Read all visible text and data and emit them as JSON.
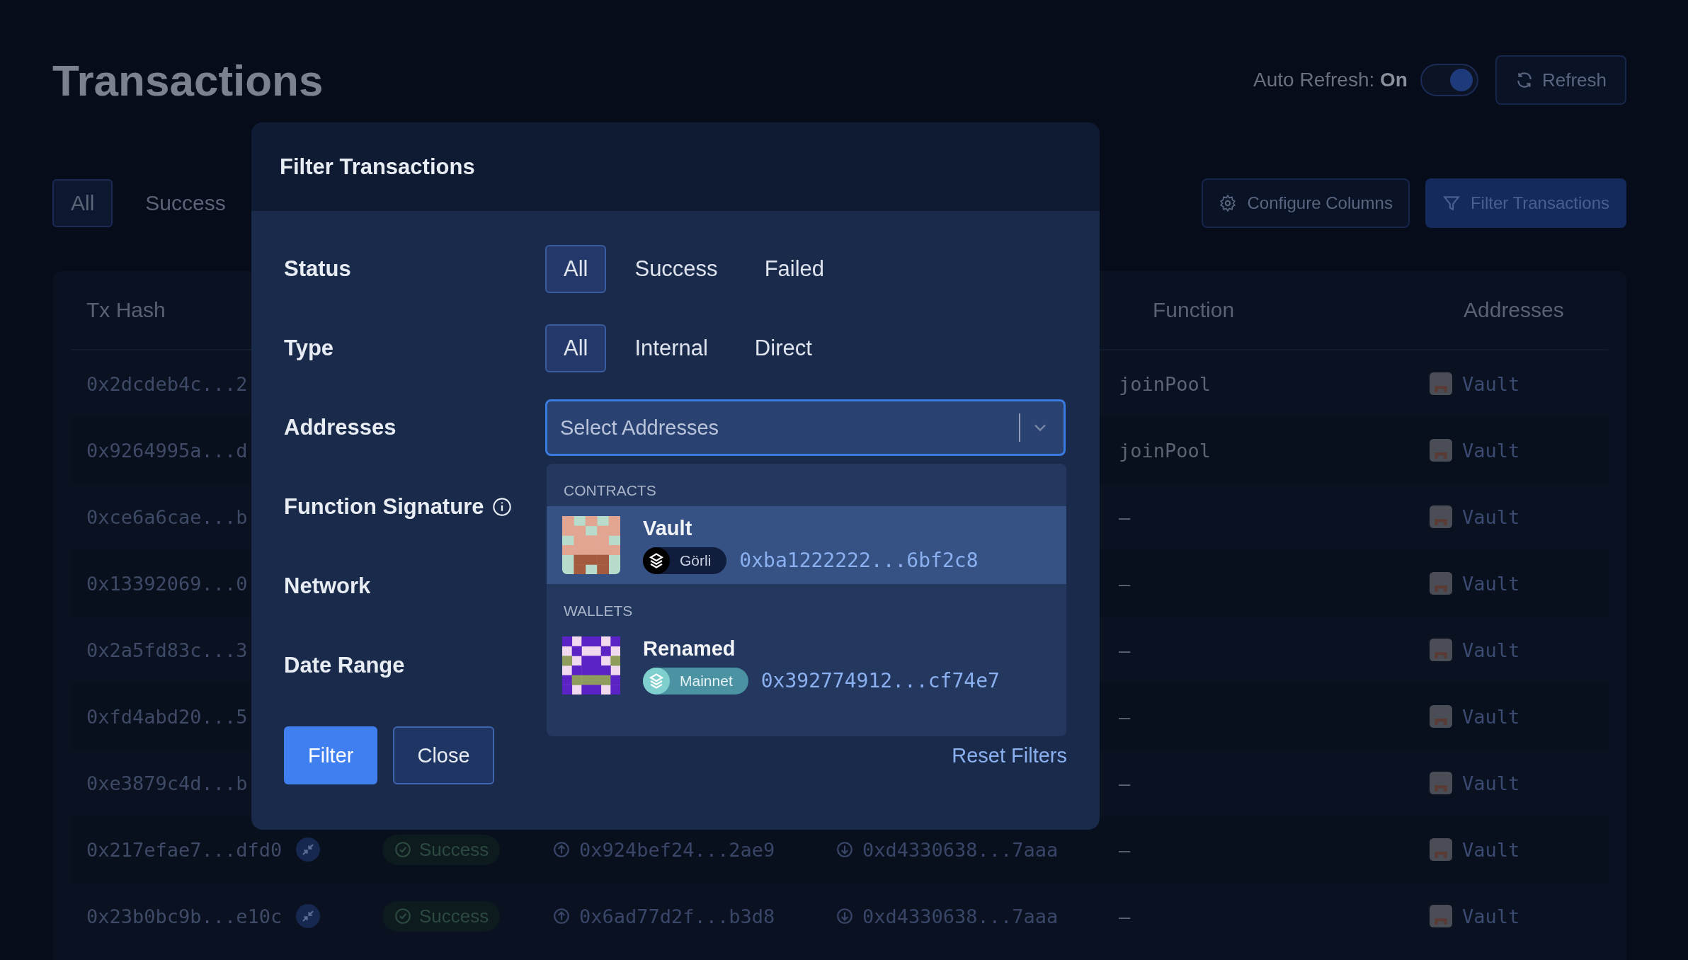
{
  "page": {
    "title": "Transactions",
    "auto_refresh": {
      "label": "Auto Refresh:",
      "value": "On",
      "on": true
    },
    "refresh_button": "Refresh"
  },
  "tabs": [
    {
      "label": "All",
      "selected": true
    },
    {
      "label": "Success",
      "selected": false
    }
  ],
  "toolbar": [
    {
      "label": "Configure Columns",
      "kind": "configure"
    },
    {
      "label": "Filter Transactions",
      "kind": "filter"
    }
  ],
  "table": {
    "columns": [
      "Tx Hash",
      "Function",
      "Addresses"
    ],
    "rows": [
      {
        "tx_hash": "0x2dcdeb4c...2",
        "function": "joinPool",
        "address": "Vault"
      },
      {
        "tx_hash": "0x9264995a...d",
        "function": "joinPool",
        "address": "Vault"
      },
      {
        "tx_hash": "0xce6a6cae...b",
        "function": "–",
        "address": "Vault"
      },
      {
        "tx_hash": "0x13392069...0",
        "function": "–",
        "address": "Vault"
      },
      {
        "tx_hash": "0x2a5fd83c...3",
        "function": "–",
        "address": "Vault"
      },
      {
        "tx_hash": "0xfd4abd20...5",
        "function": "–",
        "address": "Vault"
      },
      {
        "tx_hash": "0xe3879c4d...b",
        "function": "–",
        "address": "Vault"
      },
      {
        "tx_hash": "0x217efae7...dfd0",
        "internal": true,
        "status": "Success",
        "from": "0x924bef24...2ae9",
        "to": "0xd4330638...7aaa",
        "function": "–",
        "address": "Vault"
      },
      {
        "tx_hash": "0x23b0bc9b...e10c",
        "internal": true,
        "status": "Success",
        "from": "0x6ad77d2f...b3d8",
        "to": "0xd4330638...7aaa",
        "function": "–",
        "address": "Vault"
      }
    ]
  },
  "modal": {
    "title": "Filter Transactions",
    "status": {
      "label": "Status",
      "options": [
        {
          "label": "All",
          "selected": true
        },
        {
          "label": "Success",
          "selected": false
        },
        {
          "label": "Failed",
          "selected": false
        }
      ]
    },
    "type": {
      "label": "Type",
      "options": [
        {
          "label": "All",
          "selected": true
        },
        {
          "label": "Internal",
          "selected": false
        },
        {
          "label": "Direct",
          "selected": false
        }
      ]
    },
    "addresses": {
      "label": "Addresses",
      "placeholder": "Select Addresses",
      "focused": true,
      "groups": [
        {
          "heading": "CONTRACTS",
          "kind": "contract",
          "items": [
            {
              "name": "Vault",
              "network": {
                "label": "Görli",
                "kind": "testnet"
              },
              "address": "0xba1222222...6bf2c8",
              "highlighted": true
            }
          ]
        },
        {
          "heading": "WALLETS",
          "kind": "wallet",
          "items": [
            {
              "name": "Renamed",
              "network": {
                "label": "Mainnet",
                "kind": "mainnet"
              },
              "address": "0x392774912...cf74e7",
              "highlighted": false
            }
          ]
        }
      ]
    },
    "function_signature": {
      "label": "Function Signature"
    },
    "network": {
      "label": "Network"
    },
    "date_range": {
      "label": "Date Range"
    },
    "buttons": [
      {
        "label": "Filter",
        "kind": "primary"
      },
      {
        "label": "Close",
        "kind": "secondary"
      }
    ],
    "reset_link": "Reset Filters"
  }
}
